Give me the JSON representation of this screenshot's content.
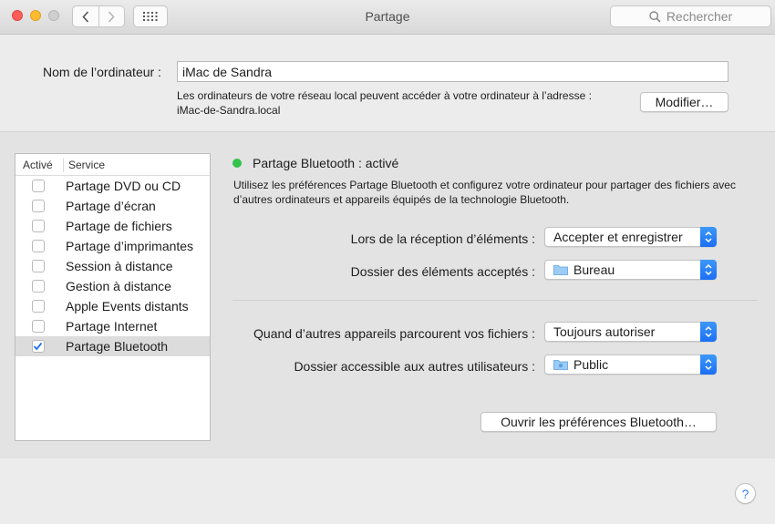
{
  "window": {
    "title": "Partage"
  },
  "toolbar": {
    "back_icon": "chevron-left-icon",
    "forward_icon": "chevron-right-icon",
    "grid_icon": "grid-icon",
    "search_placeholder": "Rechercher"
  },
  "computer": {
    "name_label": "Nom de l’ordinateur :",
    "name_value": "iMac de Sandra",
    "address_text": "Les ordinateurs de votre réseau local peuvent accéder à votre ordinateur à l’adresse :",
    "address_host": "iMac-de-Sandra.local",
    "modify_button": "Modifier…"
  },
  "services": {
    "col_active": "Activé",
    "col_service": "Service",
    "items": [
      {
        "label": "Partage DVD ou CD",
        "checked": false
      },
      {
        "label": "Partage d’écran",
        "checked": false
      },
      {
        "label": "Partage de fichiers",
        "checked": false
      },
      {
        "label": "Partage d’imprimantes",
        "checked": false
      },
      {
        "label": "Session à distance",
        "checked": false
      },
      {
        "label": "Gestion à distance",
        "checked": false
      },
      {
        "label": "Apple Events distants",
        "checked": false
      },
      {
        "label": "Partage Internet",
        "checked": false
      },
      {
        "label": "Partage Bluetooth",
        "checked": true,
        "selected": true
      }
    ]
  },
  "detail": {
    "status_title": "Partage Bluetooth : activé",
    "status_color": "#33c34b",
    "description": "Utilisez les préférences Partage Bluetooth et configurez votre ordinateur pour partager des fichiers avec d’autres ordinateurs et appareils équipés de la technologie Bluetooth.",
    "receive_label": "Lors de la réception d’éléments :",
    "receive_value": "Accepter et enregistrer",
    "accepted_folder_label": "Dossier des éléments acceptés :",
    "accepted_folder_value": "Bureau",
    "browse_label": "Quand d’autres appareils parcourent vos fichiers :",
    "browse_value": "Toujours autoriser",
    "shared_folder_label": "Dossier accessible aux autres utilisateurs :",
    "shared_folder_value": "Public",
    "open_prefs_button": "Ouvrir les préférences Bluetooth…"
  },
  "help": {
    "label": "?"
  },
  "accent_color": "#1b6ff5"
}
